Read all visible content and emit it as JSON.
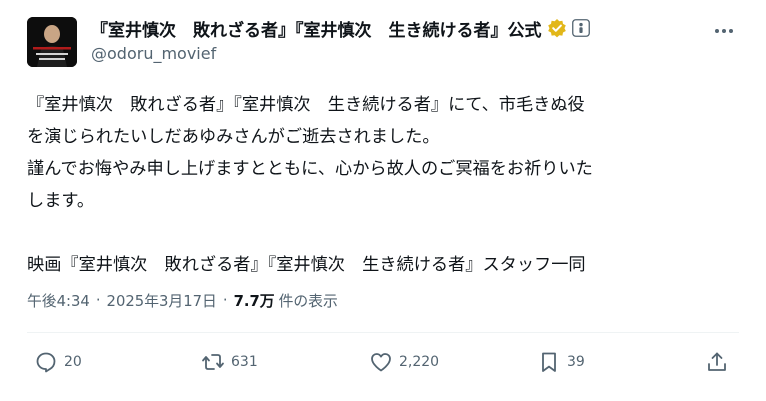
{
  "tweet": {
    "display_name": "『室井慎次　敗れざる者』『室井慎次　生き続ける者』公式",
    "handle": "@odoru_movief",
    "avatar_text": "室井慎次",
    "text_lines": [
      "『室井慎次　敗れざる者』『室井慎次　生き続ける者』にて、市毛きぬ役",
      "を演じられたいしだあゆみさんがご逝去されました。",
      "謹んでお悔やみ申し上げますとともに、心から故人のご冥福をお祈りいた",
      "します。",
      "",
      "映画『室井慎次　敗れざる者』『室井慎次　生き続ける者』スタッフ一同"
    ],
    "time": "午後4:34",
    "date": "2025年3月17日",
    "views_count": "7.7万",
    "views_label": "件の表示",
    "separator": "·"
  },
  "actions": {
    "reply_count": "20",
    "repost_count": "631",
    "like_count": "2,220",
    "bookmark_count": "39"
  },
  "icons": {
    "verified": "verified-badge-icon",
    "affiliate": "affiliate-badge-icon",
    "more": "more-icon",
    "reply": "reply-icon",
    "repost": "repost-icon",
    "like": "heart-icon",
    "bookmark": "bookmark-icon",
    "share": "share-icon"
  },
  "colors": {
    "text": "#0f1419",
    "secondary": "#536471",
    "verified_gold": "#e2b719",
    "divider": "#eff3f4"
  }
}
